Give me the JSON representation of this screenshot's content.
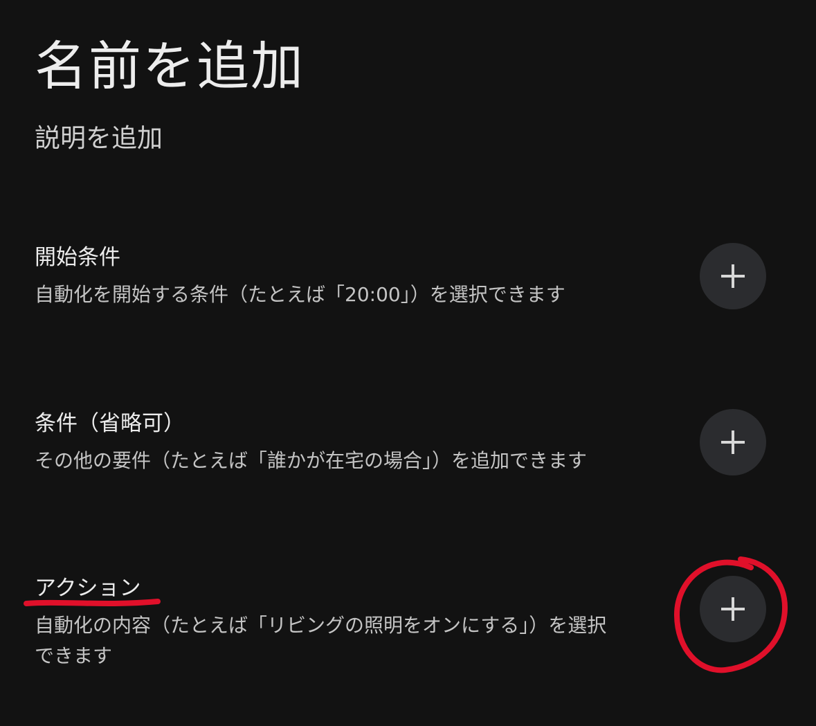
{
  "header": {
    "title": "名前を追加",
    "description": "説明を追加"
  },
  "sections": [
    {
      "title": "開始条件",
      "subtitle": "自動化を開始する条件（たとえば「20:00」）を選択できます"
    },
    {
      "title": "条件（省略可）",
      "subtitle": "その他の要件（たとえば「誰かが在宅の場合」）を追加できます"
    },
    {
      "title": "アクション",
      "subtitle": "自動化の内容（たとえば「リビングの照明をオンにする」）を選択できます"
    }
  ],
  "icons": {
    "add": "plus-icon"
  },
  "colors": {
    "background": "#121212",
    "button": "#2b2c2f",
    "annotation": "#e0102a"
  }
}
